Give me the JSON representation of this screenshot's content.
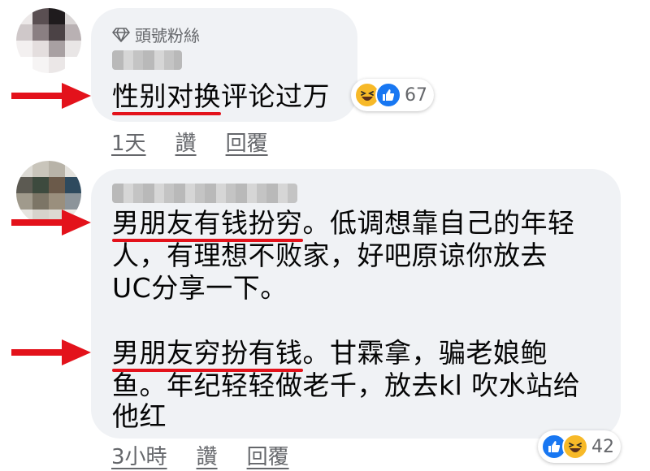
{
  "comments": [
    {
      "badge": "頭號粉絲",
      "text_lines": [
        {
          "segments": [
            {
              "text": "性别对换",
              "underline": true
            },
            {
              "text": "评论过万",
              "underline": false
            }
          ]
        }
      ],
      "reactions": {
        "icons": [
          "haha-icon",
          "like-icon"
        ],
        "count": "67"
      },
      "time": "1天",
      "like_label": "讚",
      "reply_label": "回覆"
    },
    {
      "text_lines": [
        {
          "segments": [
            {
              "text": "男朋友有钱扮穷",
              "underline": true
            },
            {
              "text": "。低调想靠自己的年轻",
              "underline": false
            }
          ]
        },
        {
          "segments": [
            {
              "text": "人，有理想不败家，好吧原谅你放去",
              "underline": false
            }
          ]
        },
        {
          "segments": [
            {
              "text": "UC分享一下。",
              "underline": false
            }
          ]
        },
        {
          "segments": [
            {
              "text": "男朋友穷扮有钱",
              "underline": true
            },
            {
              "text": "。甘霖拿，骗老娘鲍",
              "underline": false
            }
          ]
        },
        {
          "segments": [
            {
              "text": "鱼。年纪轻轻做老千，放去kl 吹水站给",
              "underline": false
            }
          ]
        },
        {
          "segments": [
            {
              "text": "他红",
              "underline": false
            }
          ]
        }
      ],
      "reactions": {
        "icons": [
          "like-icon",
          "haha-icon"
        ],
        "count": "42"
      },
      "time": "3小時",
      "like_label": "讚",
      "reply_label": "回覆"
    }
  ],
  "colors": {
    "arrow": "#e3121b",
    "bubble": "#f0f2f5",
    "like": "#1877f2",
    "haha": "#f7b928"
  }
}
